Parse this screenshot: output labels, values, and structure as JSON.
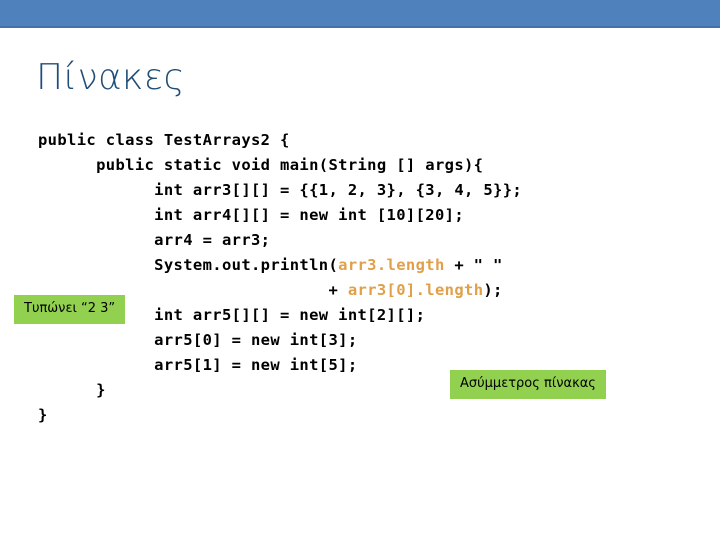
{
  "banner": {
    "color": "#4f81bd",
    "shadow_color": "#4472a8"
  },
  "title": {
    "text": "Πίνακες",
    "color": "#1f4e79"
  },
  "code": {
    "language": "java",
    "highlight_color": "#e0a04a",
    "text_color": "#000000",
    "lines": [
      {
        "plain": "public class TestArrays2 {"
      },
      {
        "plain": "      public static void main(String [] args){"
      },
      {
        "plain": "            int arr3[][] = {{1, 2, 3}, {3, 4, 5}};"
      },
      {
        "plain": "            int arr4[][] = new int [10][20];"
      },
      {
        "plain": "            arr4 = arr3;"
      },
      {
        "parts": [
          {
            "t": "            System.out.println(",
            "hl": false
          },
          {
            "t": "arr3.length",
            "hl": true
          },
          {
            "t": " + \" \"",
            "hl": false
          }
        ]
      },
      {
        "parts": [
          {
            "t": "                              + ",
            "hl": false
          },
          {
            "t": "arr3[0].length",
            "hl": true
          },
          {
            "t": ");",
            "hl": false
          }
        ]
      },
      {
        "plain": "            int arr5[][] = new int[2][];"
      },
      {
        "plain": "            arr5[0] = new int[3];"
      },
      {
        "plain": "            arr5[1] = new int[5];"
      },
      {
        "plain": "      }"
      },
      {
        "plain": "}"
      }
    ]
  },
  "callouts": {
    "prints": {
      "text": "Τυπώνει “2 3”",
      "bg": "#92d050"
    },
    "jagged": {
      "text": "Ασύμμετρος πίνακας",
      "bg": "#92d050"
    }
  }
}
